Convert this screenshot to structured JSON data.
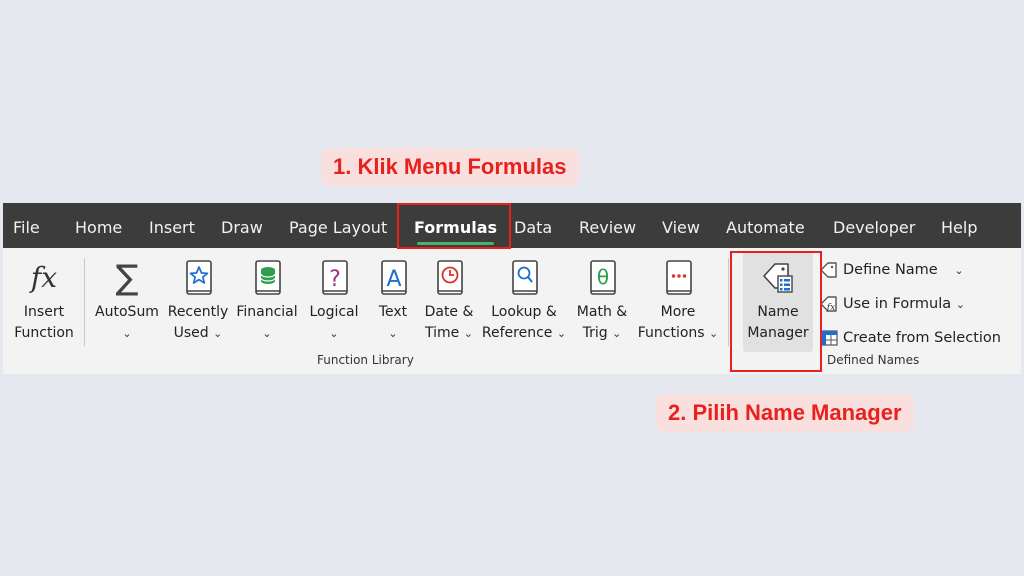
{
  "callouts": {
    "step1": "1. Klik Menu Formulas",
    "step2": "2. Pilih Name Manager"
  },
  "tabs": [
    "File",
    "Home",
    "Insert",
    "Draw",
    "Page Layout",
    "Formulas",
    "Data",
    "Review",
    "View",
    "Automate",
    "Developer",
    "Help"
  ],
  "active_tab": "Formulas",
  "function_library": {
    "group_label": "Function Library",
    "insert_function": {
      "line1": "Insert",
      "line2": "Function"
    },
    "autosum": {
      "line1": "AutoSum"
    },
    "recently_used": {
      "line1": "Recently",
      "line2": "Used"
    },
    "financial": {
      "line1": "Financial"
    },
    "logical": {
      "line1": "Logical"
    },
    "text": {
      "line1": "Text"
    },
    "date_time": {
      "line1": "Date &",
      "line2": "Time"
    },
    "lookup": {
      "line1": "Lookup &",
      "line2": "Reference"
    },
    "math_trig": {
      "line1": "Math &",
      "line2": "Trig"
    },
    "more": {
      "line1": "More",
      "line2": "Functions"
    }
  },
  "defined_names": {
    "group_label": "Defined Names",
    "name_manager": {
      "line1": "Name",
      "line2": "Manager"
    },
    "define_name": "Define Name",
    "use_in_formula": "Use in Formula",
    "create_from_selection": "Create from Selection"
  },
  "glyphs": {
    "chevron": "⌄",
    "fx": "fx",
    "sigma": "∑",
    "question": "?",
    "letter_a": "A",
    "theta": "θ"
  },
  "colors": {
    "callout_text": "#e8211c",
    "callout_bg": "#f9e0de",
    "tabbar_bg": "#3c3c3c",
    "ribbon_bg": "#f3f3f3",
    "active_underline": "#4caf6a",
    "highlight_box": "#e8211c"
  },
  "icons": [
    "fx-icon",
    "sigma-icon",
    "star-book-icon",
    "database-book-icon",
    "question-book-icon",
    "letter-a-book-icon",
    "clock-book-icon",
    "magnifier-book-icon",
    "theta-book-icon",
    "more-dots-book-icon",
    "name-tag-icon",
    "tag-icon",
    "use-formula-icon",
    "selection-grid-icon"
  ]
}
